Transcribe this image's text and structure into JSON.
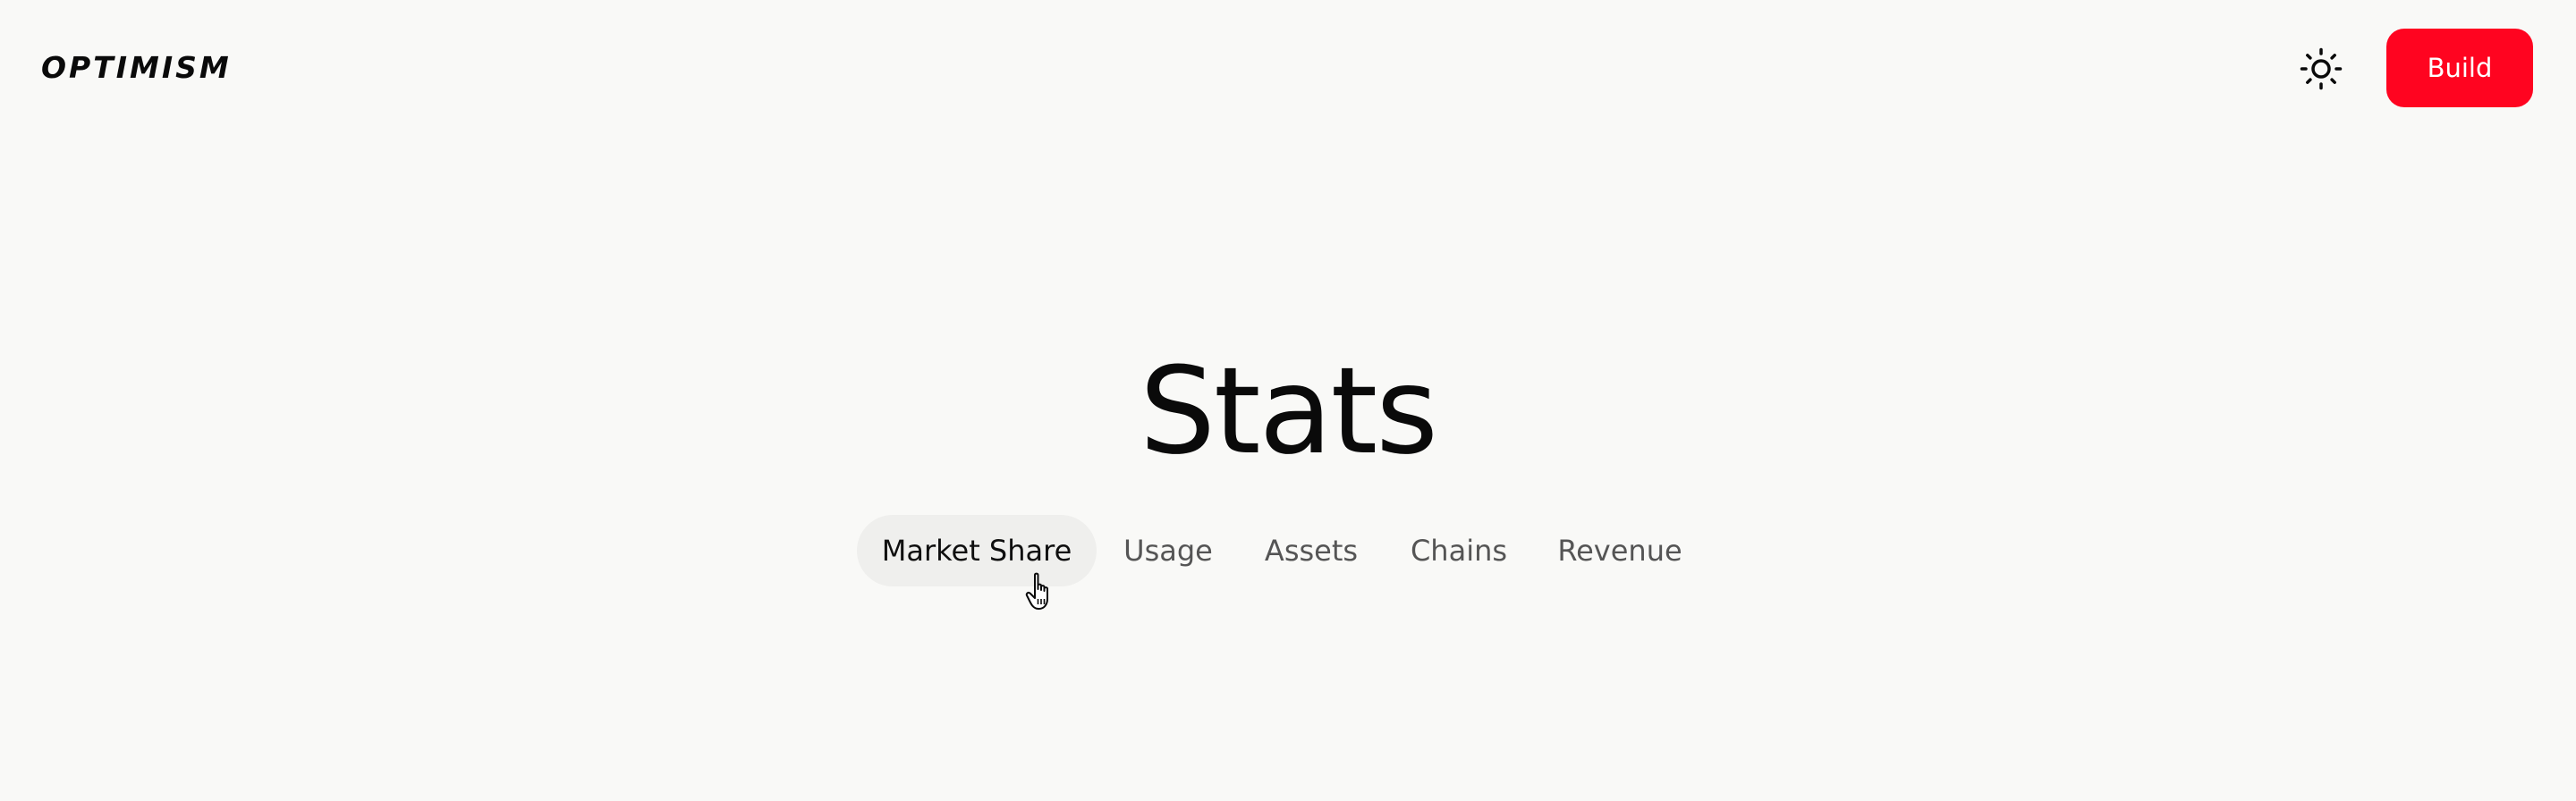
{
  "header": {
    "logo_text": "OPTIMISM",
    "theme_toggle_icon": "sun-icon",
    "build_label": "Build",
    "build_color": "#ff0420"
  },
  "main": {
    "title": "Stats",
    "tabs": [
      {
        "label": "Market Share",
        "active": true
      },
      {
        "label": "Usage",
        "active": false
      },
      {
        "label": "Assets",
        "active": false
      },
      {
        "label": "Chains",
        "active": false
      },
      {
        "label": "Revenue",
        "active": false
      }
    ]
  },
  "colors": {
    "background": "#f9f9f7",
    "accent": "#ff0420",
    "active_tab_bg": "#efefed",
    "inactive_tab_text": "#555555"
  }
}
